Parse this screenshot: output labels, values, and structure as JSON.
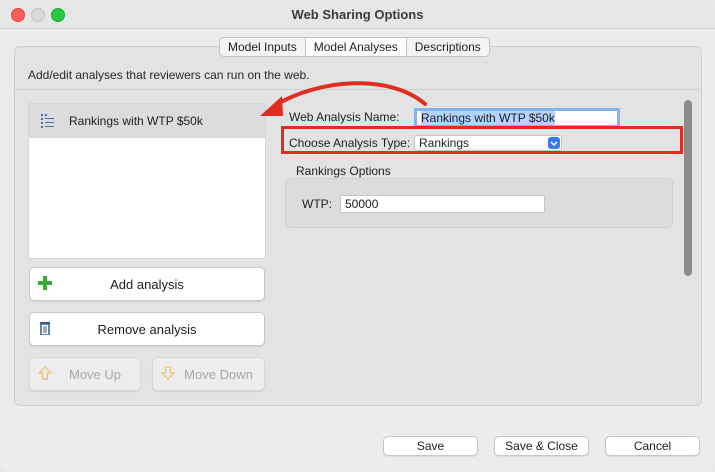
{
  "window": {
    "title": "Web Sharing Options"
  },
  "tabs": [
    {
      "label": "Model Inputs"
    },
    {
      "label": "Model Analyses",
      "active": true
    },
    {
      "label": "Descriptions"
    }
  ],
  "description": "Add/edit analyses that reviewers can run on the web.",
  "analyses_list": {
    "items": [
      {
        "label": "Rankings with WTP $50k",
        "icon": "list-icon",
        "selected": true
      }
    ]
  },
  "buttons": {
    "add": {
      "label": "Add analysis",
      "icon": "plus-icon"
    },
    "remove": {
      "label": "Remove analysis",
      "icon": "trash-icon"
    },
    "move_up": {
      "label": "Move Up",
      "icon": "arrow-up-icon",
      "enabled": false
    },
    "move_down": {
      "label": "Move Down",
      "icon": "arrow-down-icon",
      "enabled": false
    }
  },
  "form": {
    "name_label": "Web Analysis Name:",
    "name_value": "Rankings with WTP $50k",
    "type_label": "Choose Analysis Type:",
    "type_value": "Rankings"
  },
  "rankings_options": {
    "title": "Rankings Options",
    "wtp_label": "WTP:",
    "wtp_value": "50000"
  },
  "footer": {
    "save": "Save",
    "save_close": "Save & Close",
    "cancel": "Cancel"
  },
  "colors": {
    "annotation_red": "#e12c20",
    "focus_blue": "#86b3ea",
    "accent_blue": "#2f7ef5"
  }
}
